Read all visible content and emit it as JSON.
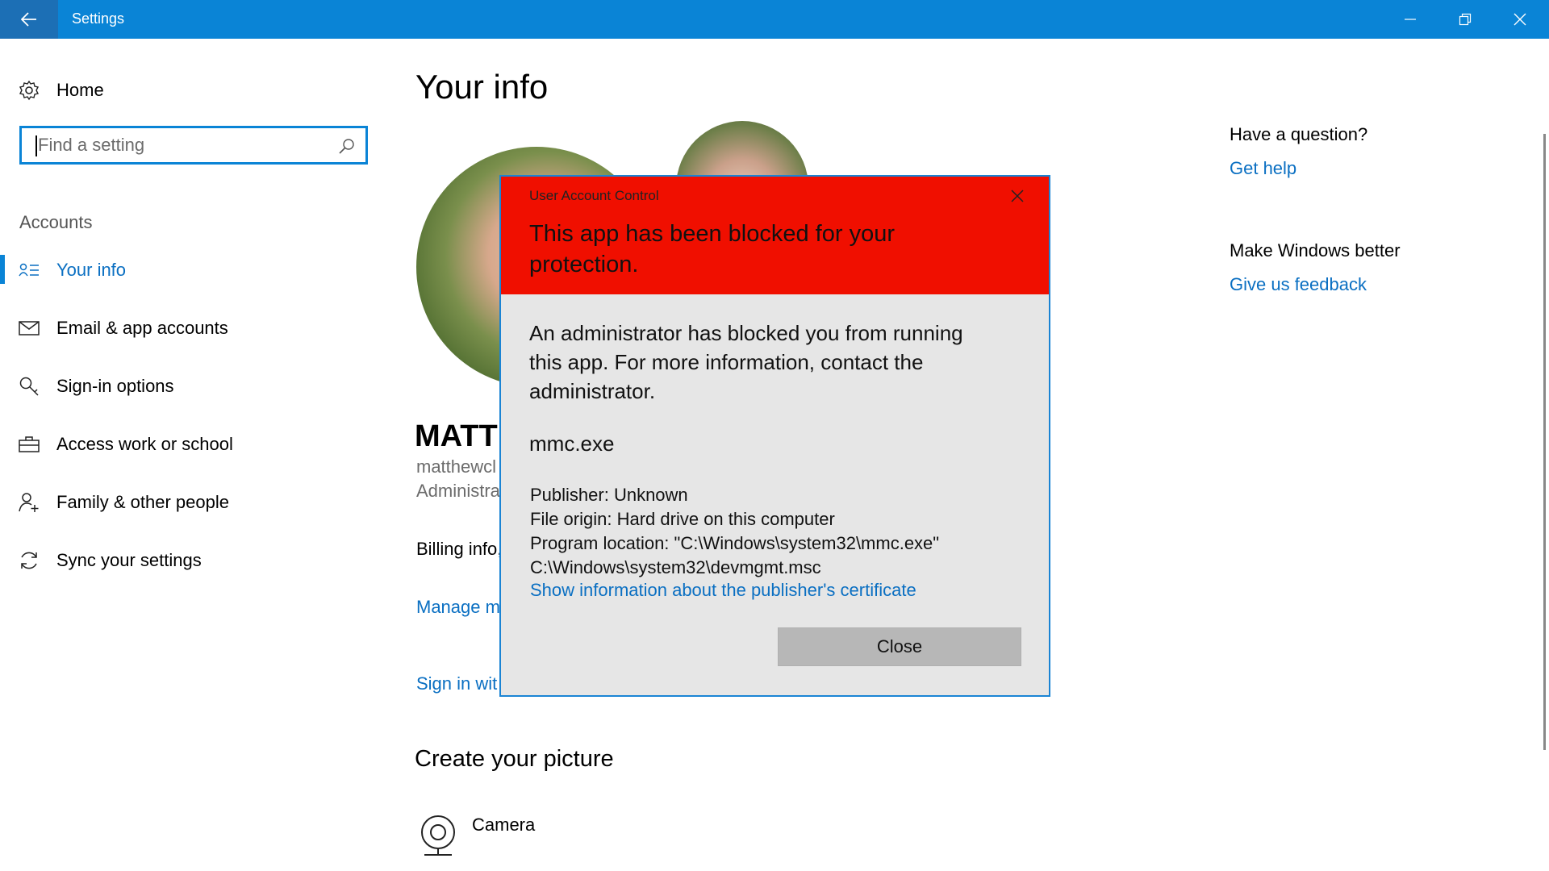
{
  "window": {
    "title": "Settings",
    "back_icon": "arrow-left-icon",
    "minimize_icon": "minimize-icon",
    "restore_icon": "restore-icon",
    "close_icon": "close-icon",
    "accent_color": "#0a84d6"
  },
  "sidebar": {
    "home_label": "Home",
    "home_icon": "gear-icon",
    "search_placeholder": "Find a setting",
    "search_value": "",
    "search_icon": "search-icon",
    "section_label": "Accounts",
    "items": [
      {
        "label": "Your info",
        "icon": "person-list-icon",
        "active": true
      },
      {
        "label": "Email & app accounts",
        "icon": "mail-icon",
        "active": false
      },
      {
        "label": "Sign-in options",
        "icon": "key-icon",
        "active": false
      },
      {
        "label": "Access work or school",
        "icon": "briefcase-icon",
        "active": false
      },
      {
        "label": "Family & other people",
        "icon": "add-person-icon",
        "active": false
      },
      {
        "label": "Sync your settings",
        "icon": "sync-icon",
        "active": false
      }
    ]
  },
  "main": {
    "title": "Your info",
    "user_name": "MATT",
    "user_email": "matthewcl",
    "user_role": "Administra",
    "billing_text": "Billing info, more",
    "manage_link": "Manage m",
    "signin_link": "Sign in wit",
    "create_picture_title": "Create your picture",
    "camera_label": "Camera",
    "camera_icon": "webcam-icon"
  },
  "right_panel": {
    "question": "Have a question?",
    "help_link": "Get help",
    "better": "Make Windows better",
    "feedback_link": "Give us feedback"
  },
  "uac_dialog": {
    "caption": "User Account Control",
    "heading": "This app has been blocked for your protection.",
    "message": "An administrator has blocked you from running this app. For more information, contact the administrator.",
    "app_name": "mmc.exe",
    "publisher": "Publisher: Unknown",
    "file_origin": "File origin: Hard drive on this computer",
    "program_location": "Program location: \"C:\\Windows\\system32\\mmc.exe\" C:\\Windows\\system32\\devmgmt.msc",
    "cert_link": "Show information about the publisher's certificate",
    "close_button": "Close",
    "header_color": "#f00f00"
  }
}
